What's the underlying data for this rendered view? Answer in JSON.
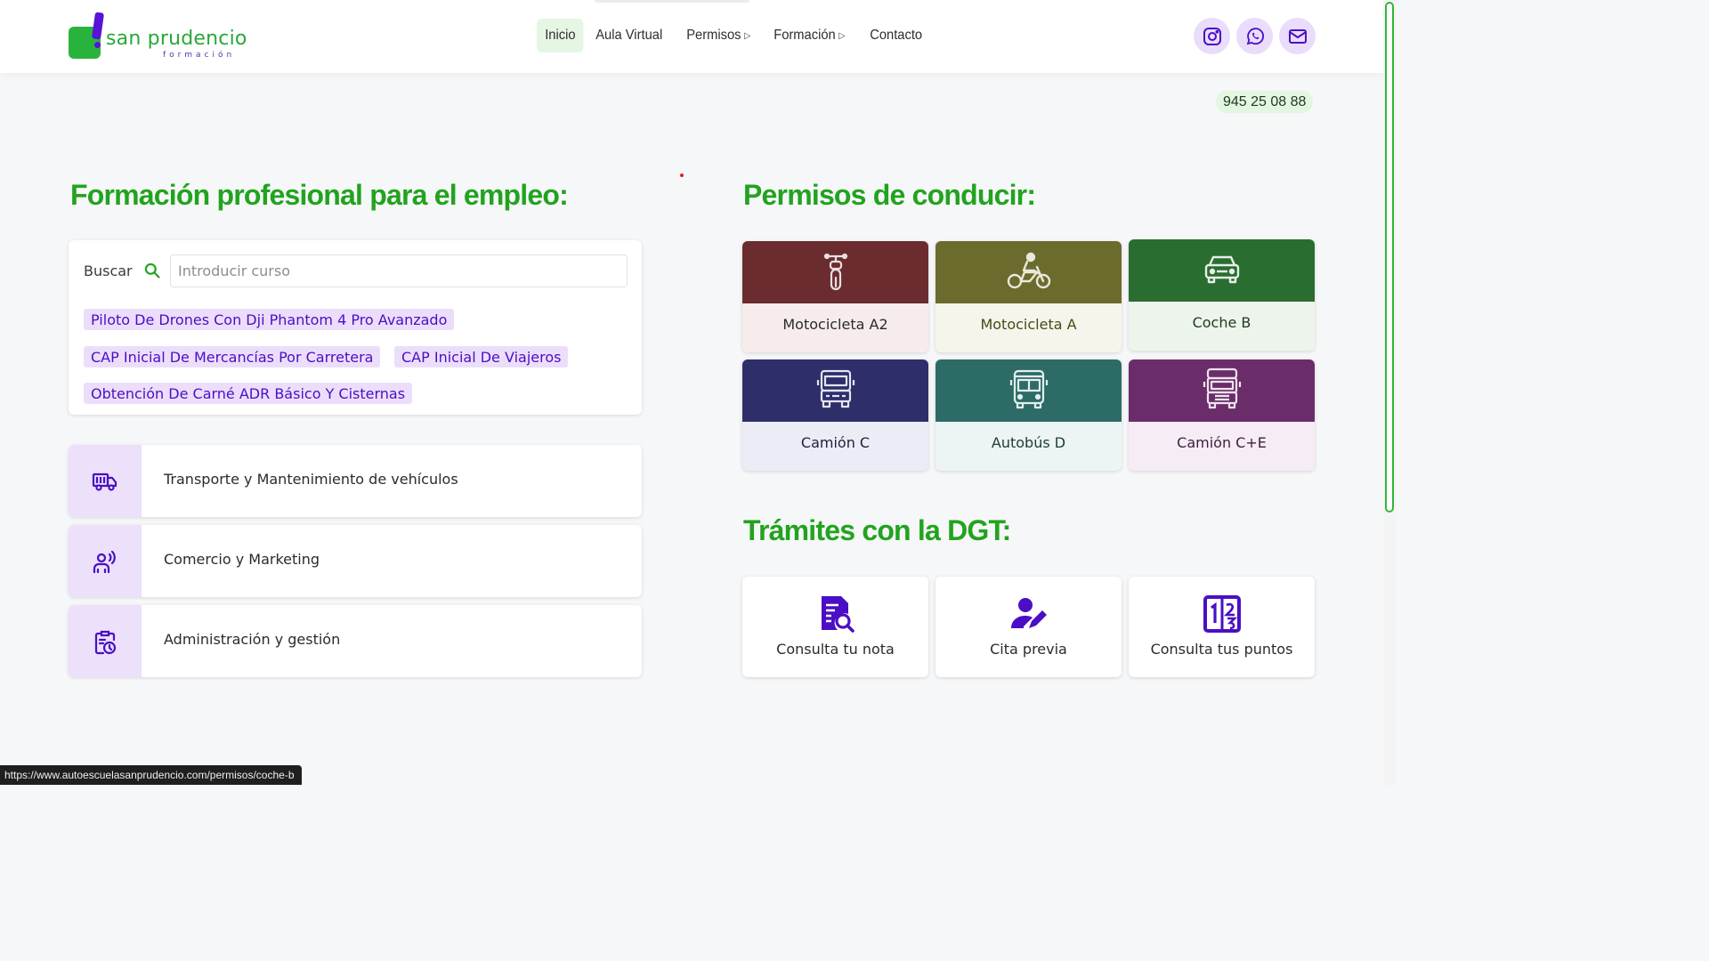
{
  "header": {
    "logo_name": "san prudencio",
    "logo_sub": "formación",
    "nav": [
      {
        "label": "Inicio",
        "arrow": ""
      },
      {
        "label": "Aula Virtual",
        "arrow": ""
      },
      {
        "label": "Permisos",
        "arrow": "▷"
      },
      {
        "label": "Formación",
        "arrow": "▷"
      },
      {
        "label": "Contacto",
        "arrow": ""
      }
    ],
    "social": [
      "instagram-icon",
      "whatsapp-icon",
      "mail-icon"
    ]
  },
  "phone": "945 25 08 88",
  "formacion": {
    "title": "Formación profesional para el empleo:",
    "search_label": "Buscar",
    "search_placeholder": "Introducir curso",
    "search_value": "",
    "tags": [
      "Piloto De Drones Con Dji Phantom 4 Pro Avanzado",
      "CAP Inicial De Mercancías Por Carretera",
      "CAP Inicial De Viajeros",
      "Obtención De Carné ADR Básico Y Cisternas"
    ],
    "categories": [
      {
        "label": "Transporte y Mantenimiento de vehículos",
        "icon": "truck-icon"
      },
      {
        "label": "Comercio y Marketing",
        "icon": "person-broadcast-icon"
      },
      {
        "label": "Administración y gestión",
        "icon": "clipboard-clock-icon"
      }
    ]
  },
  "permisos": {
    "title": "Permisos de conducir:",
    "cards": [
      {
        "label": "Motocicleta A2",
        "icon": "scooter-icon",
        "color": "#6b2c2f",
        "bg": "#f6ecec",
        "label_color": "#2b2b2b"
      },
      {
        "label": "Motocicleta A",
        "icon": "motorcycle-icon",
        "color": "#6b6b2e",
        "bg": "#f5f5ec",
        "label_color": "#4a4a18"
      },
      {
        "label": "Coche B",
        "icon": "car-icon",
        "color": "#2a6d30",
        "bg": "#ecf4ec",
        "label_color": "#1f3b1f"
      },
      {
        "label": "Camión C",
        "icon": "truck-front-icon",
        "color": "#2e2e6a",
        "bg": "#ececf6",
        "label_color": "#1f1f3b"
      },
      {
        "label": "Autobús D",
        "icon": "bus-icon",
        "color": "#2d6b66",
        "bg": "#ecf5f4",
        "label_color": "#1f3b38"
      },
      {
        "label": "Camión C+E",
        "icon": "truck-trailer-icon",
        "color": "#6a2d6a",
        "bg": "#f5ecf5",
        "label_color": "#3b1f3b"
      }
    ]
  },
  "tramites": {
    "title": "Trámites con la DGT:",
    "cards": [
      {
        "label": "Consulta tu nota",
        "icon": "document-search-icon"
      },
      {
        "label": "Cita previa",
        "icon": "user-edit-icon"
      },
      {
        "label": "Consulta tus puntos",
        "icon": "points-icon"
      }
    ]
  },
  "colors": {
    "brand_green": "#22a31e",
    "accent_purple": "#5a12d6",
    "tag_bg": "#ecdefb"
  },
  "statusbar": "https://www.autoescuelasanprudencio.com/permisos/coche-b"
}
